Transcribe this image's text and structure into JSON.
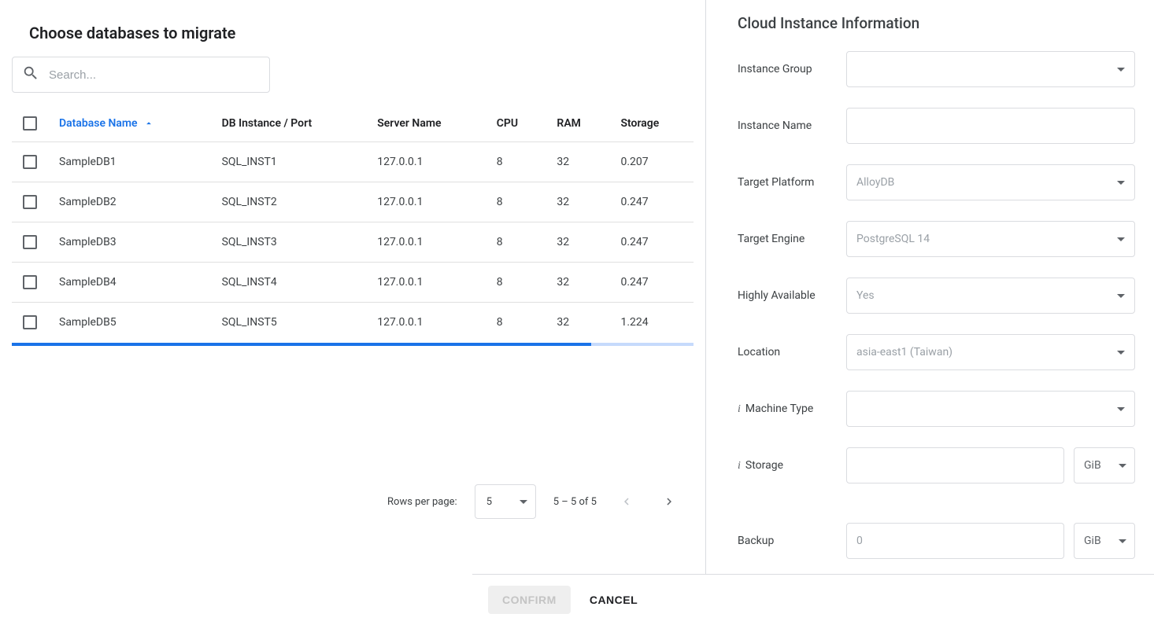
{
  "left": {
    "title": "Choose databases to migrate",
    "searchPlaceholder": "Search...",
    "columns": {
      "dbName": "Database Name",
      "instance": "DB Instance / Port",
      "server": "Server Name",
      "cpu": "CPU",
      "ram": "RAM",
      "storage": "Storage"
    },
    "rows": [
      {
        "dbName": "SampleDB1",
        "instance": "SQL_INST1",
        "server": "127.0.0.1",
        "cpu": "8",
        "ram": "32",
        "storage": "0.207"
      },
      {
        "dbName": "SampleDB2",
        "instance": "SQL_INST2",
        "server": "127.0.0.1",
        "cpu": "8",
        "ram": "32",
        "storage": "0.247"
      },
      {
        "dbName": "SampleDB3",
        "instance": "SQL_INST3",
        "server": "127.0.0.1",
        "cpu": "8",
        "ram": "32",
        "storage": "0.247"
      },
      {
        "dbName": "SampleDB4",
        "instance": "SQL_INST4",
        "server": "127.0.0.1",
        "cpu": "8",
        "ram": "32",
        "storage": "0.247"
      },
      {
        "dbName": "SampleDB5",
        "instance": "SQL_INST5",
        "server": "127.0.0.1",
        "cpu": "8",
        "ram": "32",
        "storage": "1.224"
      }
    ],
    "pagination": {
      "rowsPerPageLabel": "Rows per page:",
      "rowsPerPage": "5",
      "rangeText": "5 – 5 of 5"
    }
  },
  "right": {
    "title": "Cloud Instance Information",
    "labels": {
      "instanceGroup": "Instance Group",
      "instanceName": "Instance Name",
      "targetPlatform": "Target Platform",
      "targetEngine": "Target Engine",
      "highlyAvailable": "Highly Available",
      "location": "Location",
      "machineType": "Machine Type",
      "storage": "Storage",
      "backup": "Backup"
    },
    "values": {
      "targetPlatform": "AlloyDB",
      "targetEngine": "PostgreSQL 14",
      "highlyAvailable": "Yes",
      "location": "asia-east1 (Taiwan)",
      "backup": "0",
      "storageUnit": "GiB",
      "backupUnit": "GiB"
    }
  },
  "footer": {
    "confirm": "CONFIRM",
    "cancel": "CANCEL"
  }
}
